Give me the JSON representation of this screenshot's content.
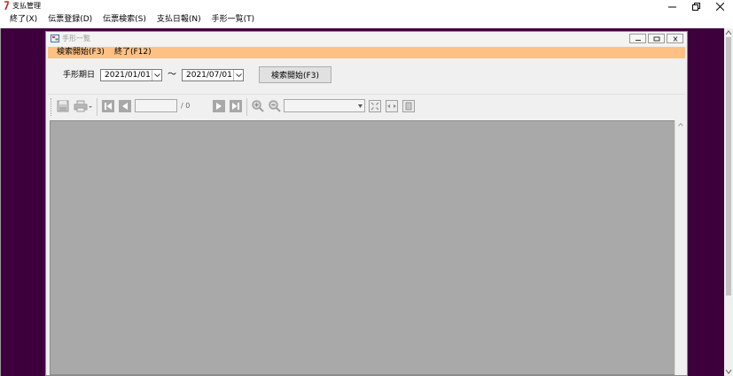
{
  "app": {
    "title": "支払管理",
    "icon": "red-hook-icon"
  },
  "window_controls": {
    "minimize": "minimize-icon",
    "maximize": "restore-icon",
    "close": "close-icon"
  },
  "menu": {
    "items": [
      {
        "label": "終了(X)"
      },
      {
        "label": "伝票登録(D)"
      },
      {
        "label": "伝票検索(S)"
      },
      {
        "label": "支払日報(N)"
      },
      {
        "label": "手形一覧(T)"
      }
    ]
  },
  "child": {
    "title": "手形一覧",
    "menu": [
      {
        "label": "検索開始(F3)"
      },
      {
        "label": "終了(F12)"
      }
    ],
    "date_label": "手形期日",
    "date_from": "2021/01/01",
    "tilde": "～",
    "date_to": "2021/07/01",
    "search_button": "検索開始(F3)",
    "toolbar": {
      "page_value": "",
      "page_total": "/ 0",
      "zoom_value": ""
    }
  },
  "colors": {
    "mdi_background": "#3d003d",
    "child_menu_bg": "#ffc183",
    "report_bg": "#a9a9a9"
  }
}
